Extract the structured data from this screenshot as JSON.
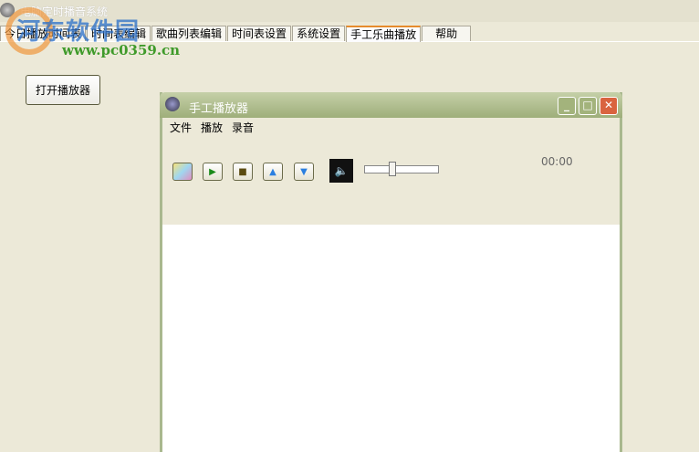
{
  "app": {
    "title": "电脑定时播音系统"
  },
  "watermark": {
    "name": "河东软件园",
    "url": "www.pc0359.cn"
  },
  "tabs": [
    "今日播放时间表",
    "时间表编辑",
    "歌曲列表编辑",
    "时间表设置",
    "系统设置",
    "手工乐曲播放",
    "帮助"
  ],
  "active_tab": 5,
  "open_player_label": "打开播放器",
  "player": {
    "title": "手工播放器",
    "menu": [
      "文件",
      "播放",
      "录音"
    ],
    "time": "00:00",
    "volume": 0.35
  }
}
